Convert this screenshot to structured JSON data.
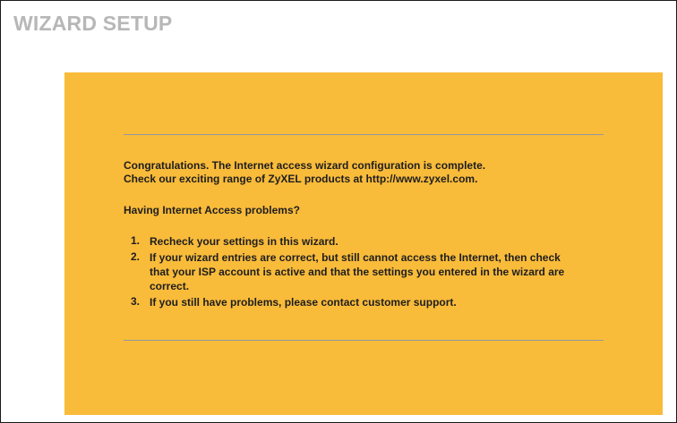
{
  "page": {
    "title": "WIZARD SETUP"
  },
  "message": {
    "line1": "Congratulations. The Internet access wizard configuration is complete.",
    "line2": "Check our exciting range of ZyXEL products at http://www.zyxel.com.",
    "question": "Having Internet Access problems?"
  },
  "steps": [
    {
      "number": "1.",
      "text": "Recheck your settings in this wizard."
    },
    {
      "number": "2.",
      "text": "If your wizard entries are correct, but still cannot access the Internet, then check that your ISP account is active and that the settings you entered in the wizard are correct."
    },
    {
      "number": "3.",
      "text": "If you still have problems, please contact customer support."
    }
  ],
  "colors": {
    "panel_background": "#f9bb3a",
    "title_text": "#b7b7b7",
    "body_text": "#1e1e1e",
    "divider": "#8e9aa3"
  }
}
